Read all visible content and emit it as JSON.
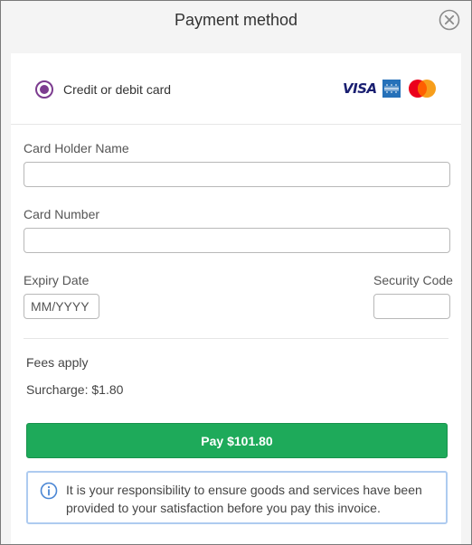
{
  "dialog": {
    "title": "Payment method",
    "close_icon": "close-circle-icon"
  },
  "payment_method": {
    "label": "Credit or debit card",
    "selected": true,
    "brands": {
      "visa": "VISA",
      "amex_icon": "amex-icon",
      "mastercard_icon": "mastercard-icon"
    },
    "accent_color": "#7c3c8f"
  },
  "form": {
    "card_holder_label": "Card Holder Name",
    "card_holder_value": "",
    "card_number_label": "Card Number",
    "card_number_value": "",
    "expiry_label": "Expiry Date",
    "expiry_placeholder": "MM/YYYY",
    "security_code_label": "Security Code",
    "security_code_value": ""
  },
  "fees": {
    "note": "Fees apply",
    "surcharge": "Surcharge: $1.80"
  },
  "pay_button": {
    "label": "Pay $101.80",
    "color": "#1eaa5a"
  },
  "notice": {
    "icon": "info-icon",
    "text": "It is your responsibility to ensure goods and services have been provided to your satisfaction before you pay this invoice.",
    "border_color": "#aecbf0"
  }
}
